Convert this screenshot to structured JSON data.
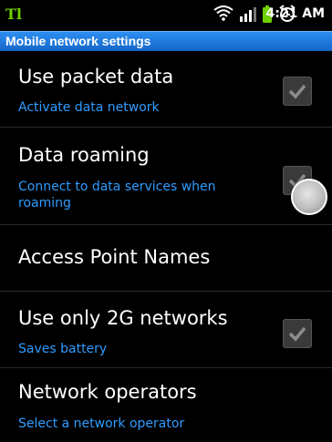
{
  "status_bar": {
    "carrier_glyph": "Tl",
    "time": "4:21 AM"
  },
  "header": {
    "title": "Mobile network settings"
  },
  "settings": [
    {
      "label": "Use packet data",
      "summary": "Activate data network",
      "checked": true
    },
    {
      "label": "Data roaming",
      "summary": "Connect to data services when roaming",
      "checked": true
    },
    {
      "label": "Access Point Names",
      "summary": ""
    },
    {
      "label": "Use only 2G networks",
      "summary": "Saves battery",
      "checked": true
    },
    {
      "label": "Network operators",
      "summary": "Select a network operator"
    }
  ],
  "colors": {
    "accent_blue": "#2f9cff",
    "title_bar": "#1f7ae0",
    "carrier_green": "#6fd000"
  },
  "icons": [
    "wifi-icon",
    "signal-icon",
    "battery-icon",
    "alarm-icon",
    "check-icon"
  ]
}
